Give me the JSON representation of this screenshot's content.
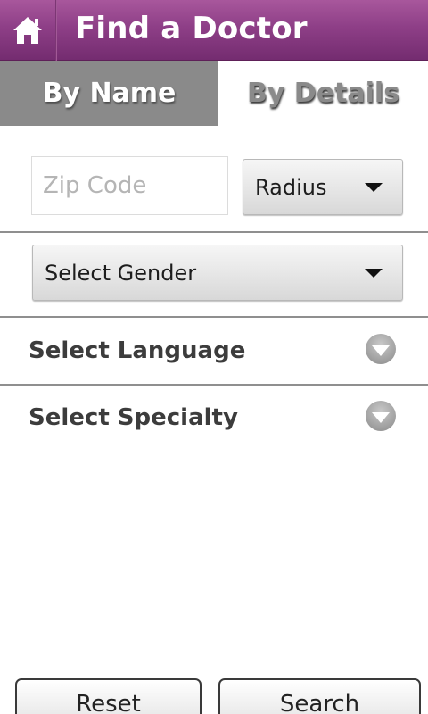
{
  "header": {
    "title": "Find a Doctor",
    "home_icon": "home-icon",
    "accent_color": "#8e3f87"
  },
  "tabs": [
    {
      "label": "By Name",
      "selected": true
    },
    {
      "label": "By Details",
      "selected": false
    }
  ],
  "zip": {
    "placeholder": "Zip Code",
    "value": ""
  },
  "radius": {
    "label": "Radius"
  },
  "gender": {
    "label": "Select Gender"
  },
  "language": {
    "label": "Select Language"
  },
  "specialty": {
    "label": "Select Specialty"
  },
  "buttons": {
    "reset": "Reset",
    "search": "Search"
  }
}
